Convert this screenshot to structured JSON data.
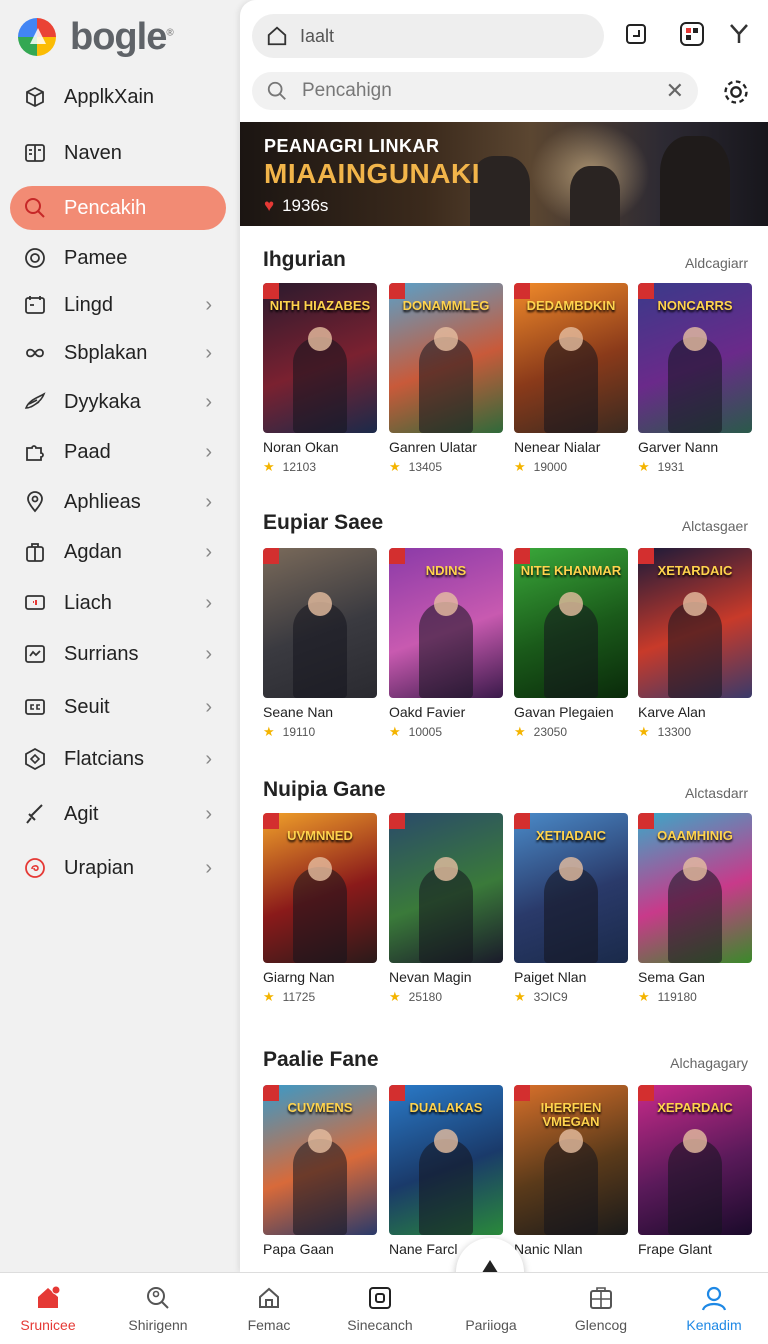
{
  "app": {
    "logo_text": "bogle",
    "logo_superscript": "®"
  },
  "sidebar": {
    "items": [
      {
        "label": "ApplkXain",
        "icon": "box-icon",
        "chevron": false,
        "active": false
      },
      {
        "label": "Naven",
        "icon": "reader-icon",
        "chevron": false,
        "active": false
      },
      {
        "label": "Pencakih",
        "icon": "search-icon",
        "chevron": false,
        "active": true
      },
      {
        "label": "Pamee",
        "icon": "circle-target-icon",
        "chevron": false,
        "active": false
      },
      {
        "label": "Lingd",
        "icon": "calendar-icon",
        "chevron": true,
        "active": false
      },
      {
        "label": "Sbplakan",
        "icon": "infinity-icon",
        "chevron": true,
        "active": false
      },
      {
        "label": "Dyykaka",
        "icon": "wing-icon",
        "chevron": true,
        "active": false
      },
      {
        "label": "Paad",
        "icon": "puzzle-icon",
        "chevron": true,
        "active": false
      },
      {
        "label": "Aphlieas",
        "icon": "location-pin-icon",
        "chevron": true,
        "active": false
      },
      {
        "label": "Agdan",
        "icon": "bag-icon",
        "chevron": true,
        "active": false
      },
      {
        "label": "Liach",
        "icon": "monitor-icon",
        "chevron": true,
        "active": false
      },
      {
        "label": "Surrians",
        "icon": "chart-card-icon",
        "chevron": true,
        "active": false
      },
      {
        "label": "Seuit",
        "icon": "caption-icon",
        "chevron": true,
        "active": false
      },
      {
        "label": "Flatcians",
        "icon": "hexagon-icon",
        "chevron": true,
        "active": false
      },
      {
        "label": "Agit",
        "icon": "sword-icon",
        "chevron": true,
        "active": false
      },
      {
        "label": "Urapian",
        "icon": "swirl-circle-icon",
        "chevron": true,
        "active": false
      }
    ]
  },
  "header": {
    "address_text": "Iaalt",
    "search_placeholder": "Pencahign"
  },
  "banner": {
    "line1": "PEANAGRI LINKAR",
    "line2": "MIAAINGUNAKI",
    "meta": "1936s"
  },
  "sections": [
    {
      "title": "Ihgurian",
      "more": "Aldcagiarr",
      "cards": [
        {
          "name": "Noran Okan",
          "rating": "12103",
          "cover_title": "NITH HIAZABES",
          "colors": [
            "#2b1a2e",
            "#7a2130",
            "#1b2a4a"
          ]
        },
        {
          "name": "Ganren Ulatar",
          "rating": "13405",
          "cover_title": "DONAMMLEG",
          "colors": [
            "#5aa0c8",
            "#c85a3a",
            "#2f6a3a"
          ]
        },
        {
          "name": "Nenear Nialar",
          "rating": "19000",
          "cover_title": "DEDAMBDKIN",
          "colors": [
            "#f08a2a",
            "#8a3a1a",
            "#3a2a20"
          ]
        },
        {
          "name": "Garver Nann",
          "rating": "1931",
          "cover_title": "NONCARRS",
          "colors": [
            "#3a3a8a",
            "#6a2a8a",
            "#2a5a4a"
          ]
        }
      ]
    },
    {
      "title": "Eupiar Saee",
      "more": "Alctasgaer",
      "cards": [
        {
          "name": "Seane Nan",
          "rating": "19110",
          "cover_title": "",
          "colors": [
            "#7a6a5a",
            "#3a3a40",
            "#2a2a30"
          ]
        },
        {
          "name": "Oakd Favier",
          "rating": "10005",
          "cover_title": "NDINS",
          "colors": [
            "#8a3aa8",
            "#c85ab0",
            "#3a1a4a"
          ]
        },
        {
          "name": "Gavan Plegaien",
          "rating": "23050",
          "cover_title": "NITE KHANMAR",
          "colors": [
            "#3aa83a",
            "#1a5a1a",
            "#0a2a0a"
          ]
        },
        {
          "name": "Karve Alan",
          "rating": "13300",
          "cover_title": "XETARDAIC",
          "colors": [
            "#1a1a3a",
            "#c83a2a",
            "#3a3a6a"
          ]
        }
      ]
    },
    {
      "title": "Nuipia Gane",
      "more": "Alctasdarr",
      "cards": [
        {
          "name": "Giarng Nan",
          "rating": "11725",
          "cover_title": "UVMNNED",
          "colors": [
            "#f0a02a",
            "#8a1a1a",
            "#2a1a1a"
          ]
        },
        {
          "name": "Nevan Magin",
          "rating": "25180",
          "cover_title": "",
          "colors": [
            "#2a4a6a",
            "#3a7a3a",
            "#1a1a2a"
          ]
        },
        {
          "name": "Paiget Nlan",
          "rating": "3ƆIC9",
          "cover_title": "XETIADAIC",
          "colors": [
            "#4a8ac8",
            "#2a3a6a",
            "#1a2a4a"
          ]
        },
        {
          "name": "Sema Gan",
          "rating": "119180",
          "cover_title": "OAAMHINIG",
          "colors": [
            "#3aa8c8",
            "#c83a8a",
            "#3a8a2a"
          ]
        }
      ]
    },
    {
      "title": "Paalie Fane",
      "more": "Alchagagary",
      "cards": [
        {
          "name": "Papa Gaan",
          "rating": "",
          "cover_title": "CUVMENS",
          "colors": [
            "#3a9ac8",
            "#d86a3a",
            "#2a3a6a"
          ]
        },
        {
          "name": "Nane Farcl",
          "rating": "",
          "cover_title": "DUALAKAS",
          "colors": [
            "#2a7ac8",
            "#1a3a6a",
            "#2a8a3a"
          ]
        },
        {
          "name": "Nanic Nlan",
          "rating": "",
          "cover_title": "IHERFIEN VMEGAN",
          "colors": [
            "#d8702a",
            "#5a3a1a",
            "#1a1a1a"
          ]
        },
        {
          "name": "Frape Glant",
          "rating": "",
          "cover_title": "XEPARDAIC",
          "colors": [
            "#c82a8a",
            "#5a1a5a",
            "#1a0a2a"
          ]
        }
      ]
    }
  ],
  "bottom_nav": [
    {
      "label": "Srunicee",
      "icon": "home-icon",
      "state": "active-red"
    },
    {
      "label": "Shirigenn",
      "icon": "search-person-icon",
      "state": ""
    },
    {
      "label": "Femac",
      "icon": "house-outline-icon",
      "state": ""
    },
    {
      "label": "Sinecanch",
      "icon": "square-target-icon",
      "state": ""
    },
    {
      "label": "Pariioga",
      "icon": "triangle-icon",
      "state": ""
    },
    {
      "label": "Glencog",
      "icon": "grid-bag-icon",
      "state": ""
    },
    {
      "label": "Kenadim",
      "icon": "person-icon",
      "state": "active-blue"
    }
  ],
  "colors": {
    "accent_red": "#e53935",
    "active_pill": "#f28b74",
    "accent_blue": "#1e88e5",
    "star": "#f4b400"
  }
}
